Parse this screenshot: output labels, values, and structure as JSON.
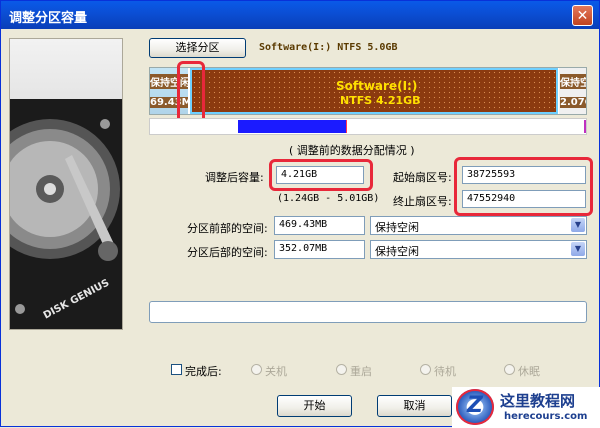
{
  "window": {
    "title": "调整分区容量",
    "close_glyph": "✕"
  },
  "side_image": {
    "brand_text": "DISK GENIUS"
  },
  "select_button": "选择分区",
  "partition_info": "Software(I:) NTFS 5.0GB",
  "map": {
    "left_top": "保持空闲",
    "left_bottom": "69.43M",
    "main_name": "Software(I:)",
    "main_detail": "NTFS 4.21GB",
    "right_top": "保持空",
    "right_bottom": "2.07G"
  },
  "section_title": "( 调整前的数据分配情况 )",
  "form": {
    "new_size_label": "调整后容量:",
    "new_size_value": "4.21GB",
    "range": "(1.24GB - 5.01GB)",
    "start_sector_label": "起始扇区号:",
    "start_sector_value": "38725593",
    "end_sector_label": "终止扇区号:",
    "end_sector_value": "47552940",
    "front_label": "分区前部的空间:",
    "front_value": "469.43MB",
    "front_option": "保持空闲",
    "back_label": "分区后部的空间:",
    "back_value": "352.07MB",
    "back_option": "保持空闲"
  },
  "after": {
    "label": "完成后:",
    "options": [
      "关机",
      "重启",
      "待机",
      "休眠"
    ]
  },
  "buttons": {
    "start": "开始",
    "cancel": "取消"
  },
  "watermark": {
    "title": "这里教程网",
    "url": "herecours.com",
    "glyph": "Z"
  },
  "colors": {
    "partition": "#8b3a0f",
    "highlight": "#e8283a",
    "titlebar": "#0a5ae8"
  }
}
